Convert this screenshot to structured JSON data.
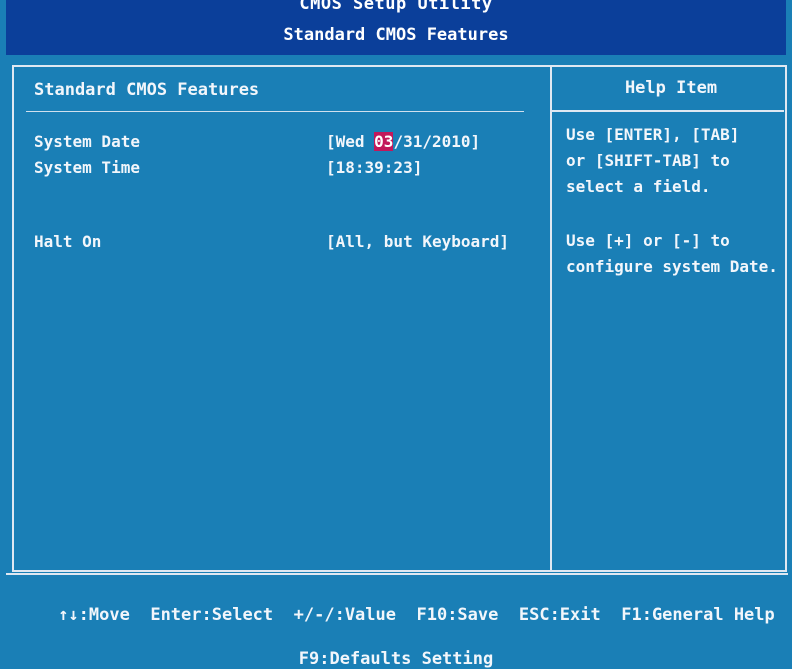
{
  "header": {
    "utility_title": "CMOS Setup Utility",
    "page_title": "Standard CMOS Features"
  },
  "main": {
    "section_heading": "Standard CMOS Features",
    "settings": [
      {
        "label": "System Date",
        "value_prefix": "[Wed ",
        "value_highlight": "03",
        "value_suffix": "/31/2010]"
      },
      {
        "label": "System Time",
        "value": "[18:39:23]"
      },
      {
        "label": "Halt On",
        "value": "[All, but Keyboard]"
      }
    ]
  },
  "help": {
    "heading": "Help Item",
    "block1": [
      "Use [ENTER], [TAB]",
      "or [SHIFT-TAB] to",
      "select a field."
    ],
    "block2": [
      "Use [+] or [-] to",
      "configure system Date."
    ]
  },
  "footer": {
    "keys": [
      {
        "label": "↑↓:Move"
      },
      {
        "label": "Enter:Select"
      },
      {
        "label": "+/-/:Value"
      },
      {
        "label": "F10:Save"
      },
      {
        "label": "ESC:Exit"
      },
      {
        "label": "F1:General Help"
      }
    ],
    "defaults": "F9:Defaults Setting"
  },
  "colors": {
    "background": "#1a7fb6",
    "title_bar": "#0b3f9a",
    "highlight": "#c2185b",
    "text": "#f2f6fb"
  }
}
